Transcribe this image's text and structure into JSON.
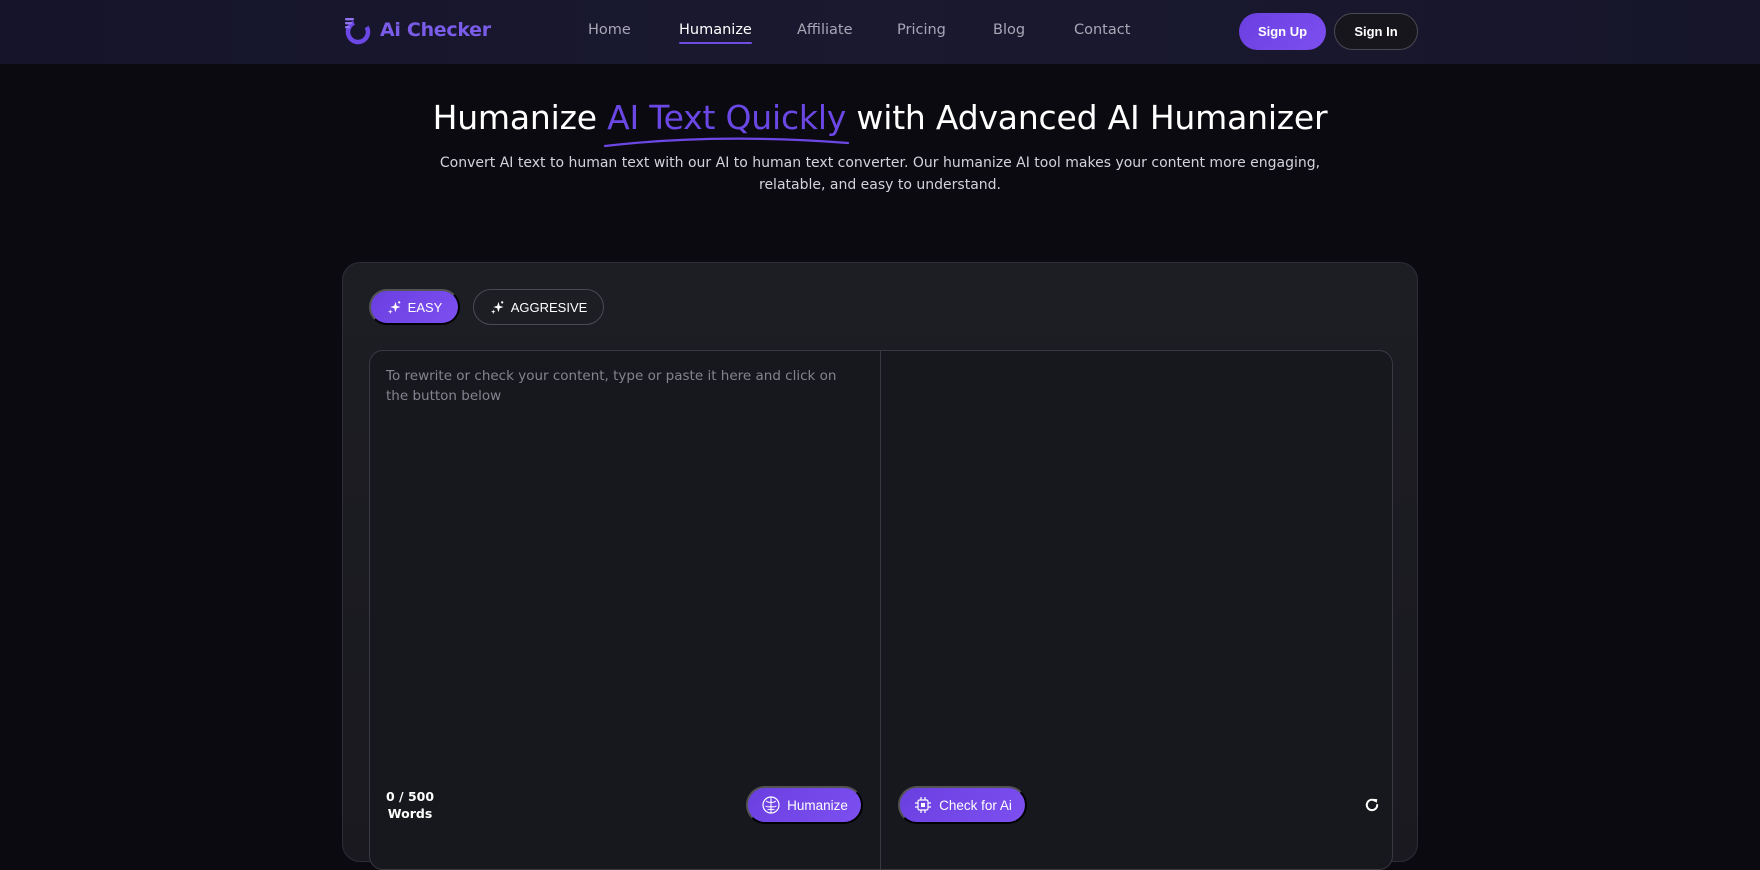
{
  "brand": {
    "name": "Ai Checker",
    "logo_icon": "ai-checker-logo-icon",
    "accent": "#6b48e6"
  },
  "nav": {
    "items": [
      {
        "label": "Home",
        "active": false
      },
      {
        "label": "Humanize",
        "active": true
      },
      {
        "label": "Affiliate",
        "active": false
      },
      {
        "label": "Pricing",
        "active": false
      },
      {
        "label": "Blog",
        "active": false
      },
      {
        "label": "Contact",
        "active": false
      }
    ],
    "sign_up": "Sign Up",
    "sign_in": "Sign In"
  },
  "hero": {
    "title_before": "Humanize ",
    "title_accent": "AI Text Quickly",
    "title_after": " with Advanced AI Humanizer",
    "subtitle": "Convert AI text to human text with our AI to human text converter. Our humanize AI tool makes your content more engaging, relatable, and easy to understand."
  },
  "tool": {
    "modes": [
      {
        "label": "EASY",
        "icon": "sparkle-icon",
        "selected": true
      },
      {
        "label": "AGGRESIVE",
        "icon": "sparkle-icon",
        "selected": false
      }
    ],
    "input_placeholder": "To rewrite or check your content, type or paste it here and click on the button below",
    "input_value": "",
    "word_count": "0 / 500",
    "word_unit": "Words",
    "humanize_label": "Humanize",
    "humanize_icon": "brain-icon",
    "check_label": "Check for Ai",
    "check_icon": "chip-icon",
    "refresh_icon": "refresh-icon"
  }
}
